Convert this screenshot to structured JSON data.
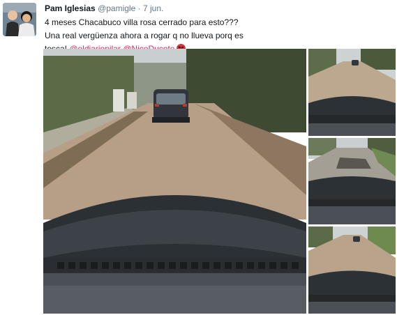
{
  "tweet": {
    "author_name": "Pam Iglesias",
    "author_handle": "@pamigle",
    "separator": "·",
    "date": "7 jun.",
    "text": "4 meses Chacabuco villa rosa cerrado para esto??? Una real vergüenza ahora a rogar q no llueva porq es tosca!",
    "mentions": [
      "@eldiariopilar",
      "@NicoDucote"
    ],
    "emoji": "angry-face-emoji"
  },
  "media": {
    "photos": [
      {
        "name": "main-photo",
        "subject": "car-on-dirt-road"
      },
      {
        "name": "thumb-photo-1",
        "subject": "dirt-road-from-dashboard"
      },
      {
        "name": "thumb-photo-2",
        "subject": "road-with-pothole"
      },
      {
        "name": "thumb-photo-3",
        "subject": "car-on-dirt-road"
      }
    ]
  },
  "colors": {
    "mention": "#e0245e",
    "name": "#14171a",
    "meta": "#657786"
  }
}
